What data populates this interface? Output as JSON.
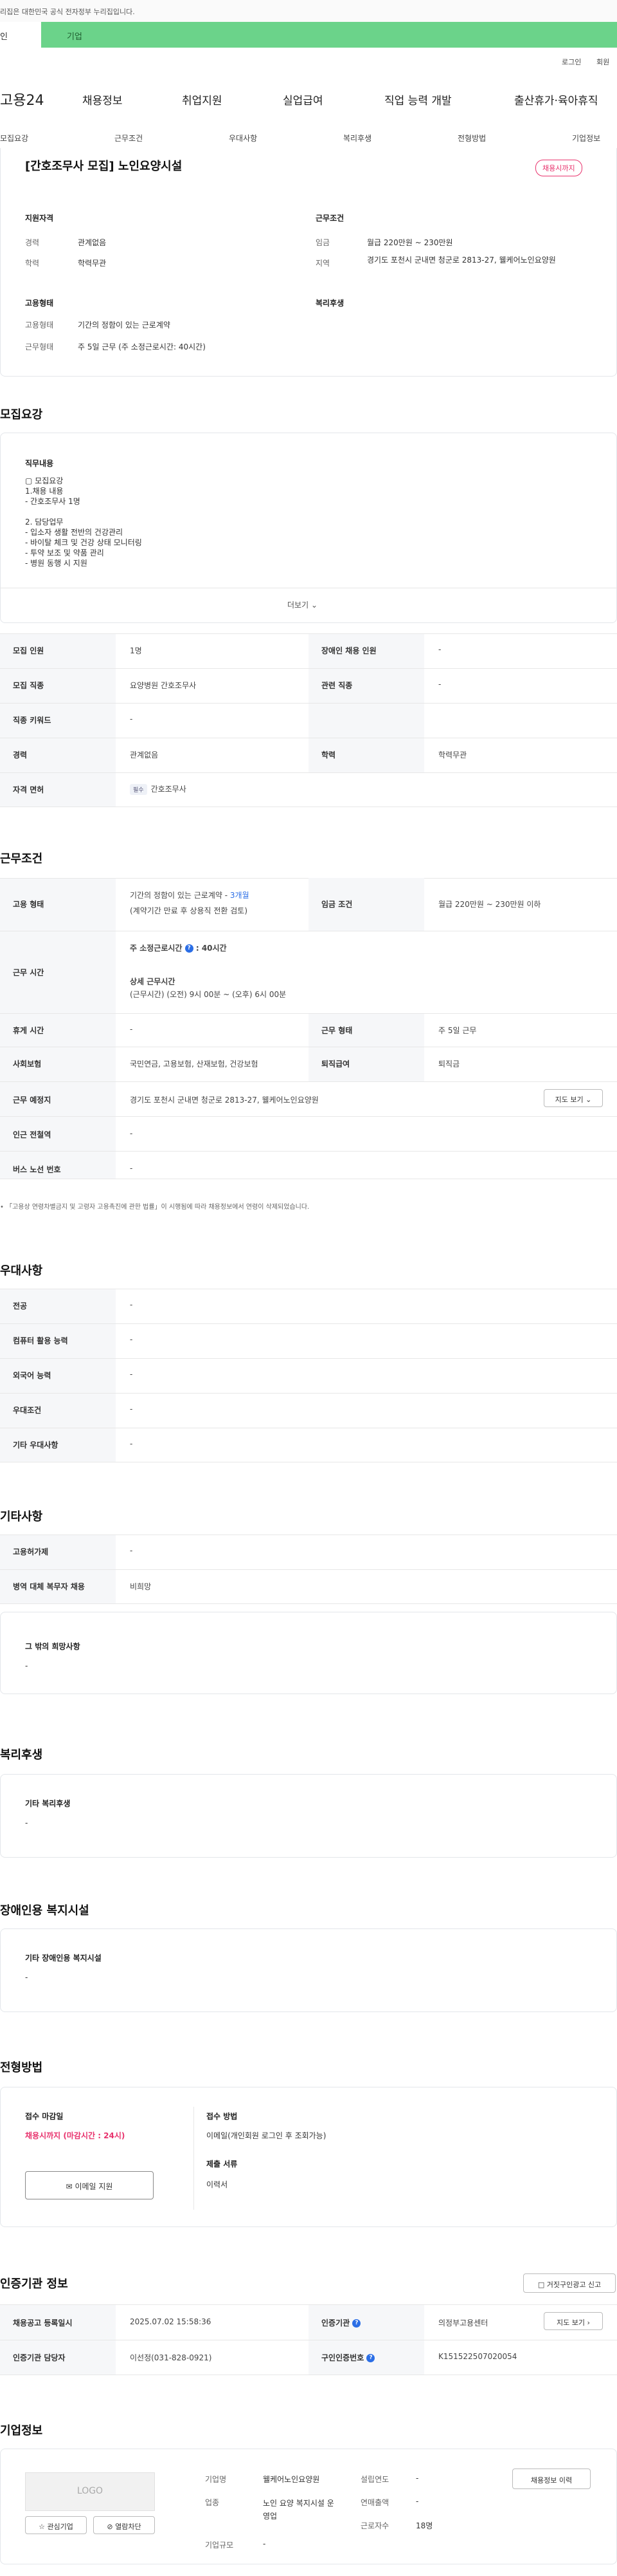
{
  "notice": "이 누리집은 대한민국 공식 전자정부 누리집입니다.",
  "notice_prefix": "이 누리집은",
  "notice_text": "리집은 대한민국 공식 전자정부 누리집입니다.",
  "tabs": {
    "individual": "인",
    "company": "기업"
  },
  "utility": {
    "login": "로그인",
    "signup": "회원"
  },
  "nav": {
    "logo": "고용24",
    "items": [
      "채용정보",
      "취업지원",
      "실업급여",
      "직업 능력 개발",
      "출산휴가·육아휴직"
    ]
  },
  "subnav": [
    "모집요강",
    "근무조건",
    "우대사항",
    "복리후생",
    "전형방법",
    "기업정보"
  ],
  "summary": {
    "title": "[간호조무사 모집] 노인요양시설",
    "badge": "채용시까지",
    "qual_head": "지원자격",
    "career_label": "경력",
    "career_value": "관계없음",
    "edu_label": "학력",
    "edu_value": "학력무관",
    "cond_head": "근무조건",
    "wage_label": "임금",
    "wage_value": "월급 220만원 ~ 230만원",
    "area_label": "지역",
    "area_value": "경기도 포천시 군내면 청군로 2813-27, 웰케어노인요양원",
    "emp_head": "고용형태",
    "emp_label": "고용형태",
    "emp_value": "기간의 정함이 있는 근로계약",
    "hours_label": "근무형태",
    "hours_value": "주 5일 근무 (주 소정근로시간: 40시간)",
    "welfare_head": "복리후생"
  },
  "recruit": {
    "title": "모집요강",
    "job_head": "직무내용",
    "job_body": "▢ 모집요강\n1.채용 내용\n- 간호조무사 1명\n\n2. 담당업무\n- 입소자 생활 전반의 건강관리\n- 바이탈 체크 및 건강 상태 모니터링\n- 투약 보조 및 약품 관리\n- 병원 동행 시 지원",
    "more": "더보기",
    "rows": {
      "count_label": "모집 인원",
      "count_value": "1명",
      "disabled_label": "장애인 채용 인원",
      "disabled_value": "-",
      "job_label": "모집 직종",
      "job_value": "요양병원 간호조무사",
      "related_label": "관련 직종",
      "related_value": "-",
      "keyword_label": "직종 키워드",
      "keyword_value": "-",
      "career_label": "경력",
      "career_value": "관계없음",
      "edu_label": "학력",
      "edu_value": "학력무관",
      "license_label": "자격 면허",
      "license_tag": "필수",
      "license_value": "간호조무사"
    }
  },
  "conditions": {
    "title": "근무조건",
    "emp_label": "고용 형태",
    "emp_value": "기간의 정함이 있는 근로계약 - ",
    "emp_months": "3개월",
    "emp_sub": "(계약기간 만료 후 상용직 전환 검토)",
    "wage_label": "임금 조건",
    "wage_value": "월급 220만원 ~ 230만원 이하",
    "time_label": "근무 시간",
    "weekly": "주 소정근로시간",
    "weekly_value": ": 40시간",
    "detail_head": "상세 근무시간",
    "detail_value": "(근무시간) (오전) 9시 00분 ~ (오후) 6시 00분",
    "rest_label": "휴게 시간",
    "rest_value": "-",
    "worktype_label": "근무 형태",
    "worktype_value": "주 5일 근무",
    "insurance_label": "사회보험",
    "insurance_value": "국민연금, 고용보험, 산재보험, 건강보험",
    "severance_label": "퇴직급여",
    "severance_value": "퇴직금",
    "place_label": "근무 예정지",
    "place_value": "경기도 포천시 군내면 청군로 2813-27, 웰케어노인요양원",
    "map_btn": "지도 보기",
    "subway_label": "인근 전철역",
    "subway_value": "-",
    "bus_label": "버스 노선 번호",
    "bus_value": "-",
    "law_note": "「고용상 연령차별금지 및 고령자 고용촉진에 관한 법률」이 시행됨에 따라 채용정보에서 연령이 삭제되었습니다."
  },
  "preference": {
    "title": "우대사항",
    "rows": [
      {
        "label": "전공",
        "value": "-"
      },
      {
        "label": "컴퓨터 활용 능력",
        "value": "-"
      },
      {
        "label": "외국어 능력",
        "value": "-"
      },
      {
        "label": "우대조건",
        "value": "-"
      },
      {
        "label": "기타 우대사항",
        "value": "-"
      }
    ]
  },
  "etc": {
    "title": "기타사항",
    "support_label": "고용허가제",
    "support_value": "-",
    "military_label": "병역 대체 복무자 채용",
    "military_value": "비희망",
    "other_head": "그 밖의 희망사항",
    "other_value": "-"
  },
  "welfare": {
    "title": "복리후생",
    "head": "기타 복리후생",
    "value": "-"
  },
  "disabled_facility": {
    "title": "장애인용 복지시설",
    "head": "기타 장애인용 복지시설",
    "value": "-"
  },
  "selection": {
    "title": "전형방법",
    "deadline_head": "접수 마감일",
    "deadline_value": "채용시까지 (마감시간 : 24시)",
    "email_btn": "이메일 지원",
    "method_head": "접수 방법",
    "method_value": "이메일(개인회원 로그인 후 조회가능)",
    "docs_head": "제출 서류",
    "docs_value": "이력서"
  },
  "agency": {
    "title": "인증기관 정보",
    "print_btn": "거짓구인광고 신고",
    "reg_label": "채용공고 등록일시",
    "reg_value": "2025.07.02 15:58:36",
    "agency_label": "인증기관",
    "agency_value": "의정부고용센터",
    "map_btn": "지도 보기",
    "manager_label": "인증기관 담당자",
    "manager_value": "이선정(031-828-0921)",
    "number_label": "구인인증번호",
    "number_value": "K151522507020054"
  },
  "company": {
    "title": "기업정보",
    "logo_placeholder": "LOGO",
    "fav_btn": "관심기업",
    "block_btn": "열람차단",
    "name_label": "기업명",
    "name_value": "웰케어노인요양원",
    "ind_label": "업종",
    "ind_value": "노인 요양 복지시설 운영업",
    "size_label": "기업규모",
    "size_value": "-",
    "year_label": "설립연도",
    "year_value": "-",
    "sales_label": "연매출액",
    "sales_value": "-",
    "emp_label": "근로자수",
    "emp_value": "18명",
    "history_btn": "채용정보 이력"
  }
}
